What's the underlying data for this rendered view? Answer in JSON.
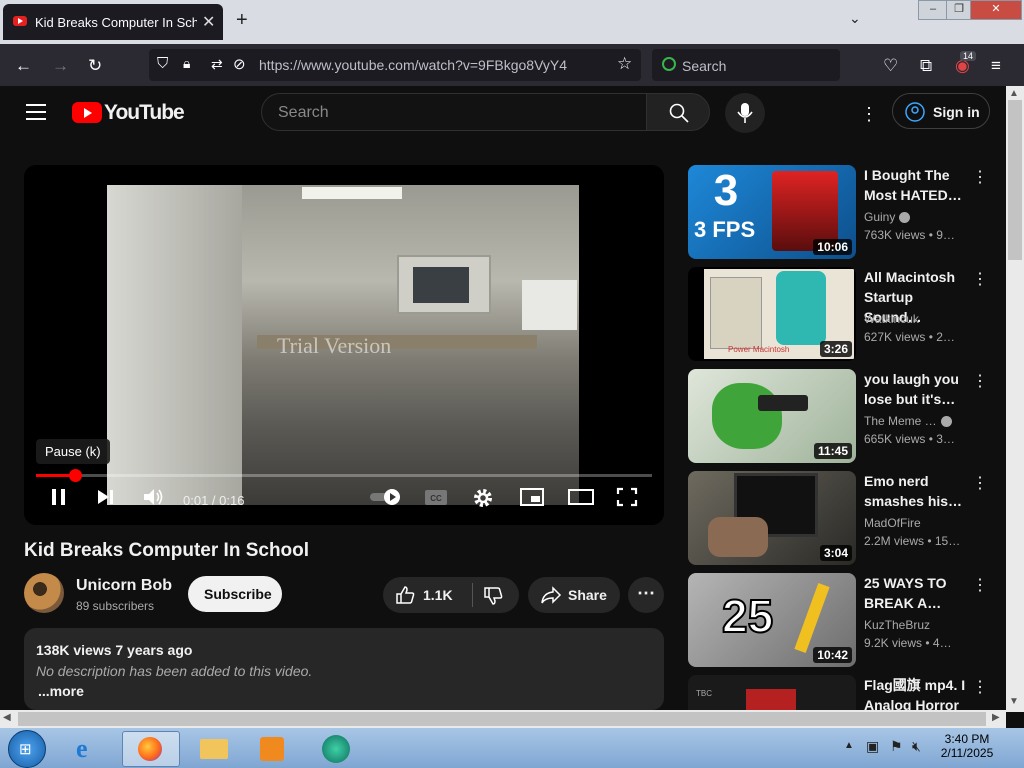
{
  "browser": {
    "tab_title": "Kid Breaks Computer In School",
    "new_tab": "+",
    "close_tab": "✕",
    "url": "https://www.youtube.com/watch?v=9FBkgo8VyY4",
    "search_placeholder": "Search",
    "extensions_badge": "14"
  },
  "masthead": {
    "logo_text": "YouTube",
    "search_placeholder": "Search",
    "sign_in": "Sign in"
  },
  "player": {
    "watermark": "Trial Version",
    "tooltip": "Pause (k)",
    "time": "0:01 / 0:16",
    "progress_fraction": 0.0625,
    "cc_label": "CC"
  },
  "video": {
    "title": "Kid Breaks Computer In School",
    "channel": "Unicorn Bob",
    "subscribers": "89 subscribers",
    "subscribe": "Subscribe",
    "likes": "1.1K",
    "share": "Share",
    "views_date": "138K views  7 years ago",
    "description": "No description has been added to this video.",
    "more": "...more"
  },
  "recommendations": [
    {
      "title": "I Bought The Most HATED…",
      "channel": "Guiny",
      "verified": true,
      "views": "763K views  • 9…",
      "duration": "10:06",
      "thumb_text": "3 FPS",
      "thumb_color": "#1e88d8"
    },
    {
      "title": "All Macintosh Startup Sound…",
      "channel": "Watkincuk",
      "verified": false,
      "views": "627K views  • 2…",
      "duration": "3:26",
      "thumb_text": "Power Macintosh",
      "thumb_color": "#e9e4d6"
    },
    {
      "title": "you laugh you lose but it's…",
      "channel": "The Meme …",
      "verified": true,
      "views": "665K views  • 3…",
      "duration": "11:45",
      "thumb_text": "",
      "thumb_color": "#c9d6c2"
    },
    {
      "title": "Emo nerd smashes his…",
      "channel": "MadOfFire",
      "verified": false,
      "views": "2.2M views  • 15…",
      "duration": "3:04",
      "thumb_text": "",
      "thumb_color": "#3a3a36"
    },
    {
      "title": "25 WAYS TO BREAK A…",
      "channel": "KuzTheBruz",
      "verified": false,
      "views": "9.2K views  • 4…",
      "duration": "10:42",
      "thumb_text": "25",
      "thumb_color": "#9a9a9a"
    },
    {
      "title": "Flag國旗 mp4. I Analog Horror",
      "channel": "",
      "verified": false,
      "views": "",
      "duration": "",
      "thumb_text": "TBC",
      "thumb_color": "#1a1a1a"
    }
  ],
  "taskbar": {
    "time": "3:40 PM",
    "date": "2/11/2025"
  }
}
